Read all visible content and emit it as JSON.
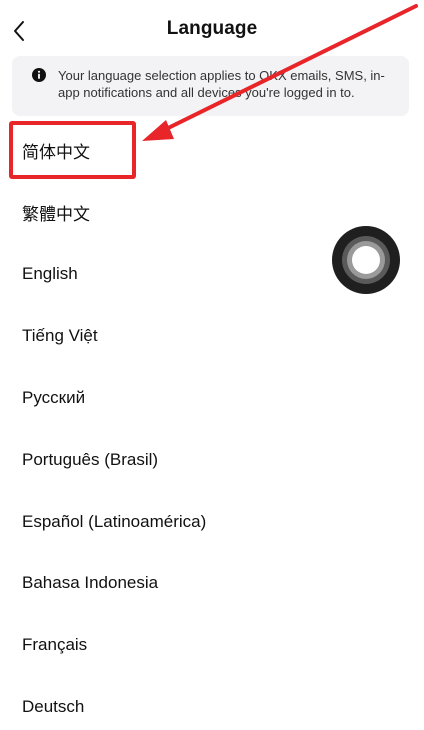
{
  "header": {
    "title": "Language"
  },
  "notice": {
    "text": "Your language selection applies to OKX emails, SMS, in-app notifications and all devices you're logged in to."
  },
  "languages": [
    {
      "label": "简体中文"
    },
    {
      "label": "繁體中文"
    },
    {
      "label": "English"
    },
    {
      "label": "Tiếng Việt"
    },
    {
      "label": "Русский"
    },
    {
      "label": "Português (Brasil)"
    },
    {
      "label": "Español (Latinoamérica)"
    },
    {
      "label": "Bahasa Indonesia"
    },
    {
      "label": "Français"
    },
    {
      "label": "Deutsch"
    }
  ],
  "colors": {
    "annotation_red": "#e8262a",
    "notice_background": "#f3f3f5",
    "text_primary": "#111111"
  },
  "icons": {
    "back": "chevron-left-icon",
    "info": "info-icon",
    "floating": "assistive-touch-icon"
  }
}
